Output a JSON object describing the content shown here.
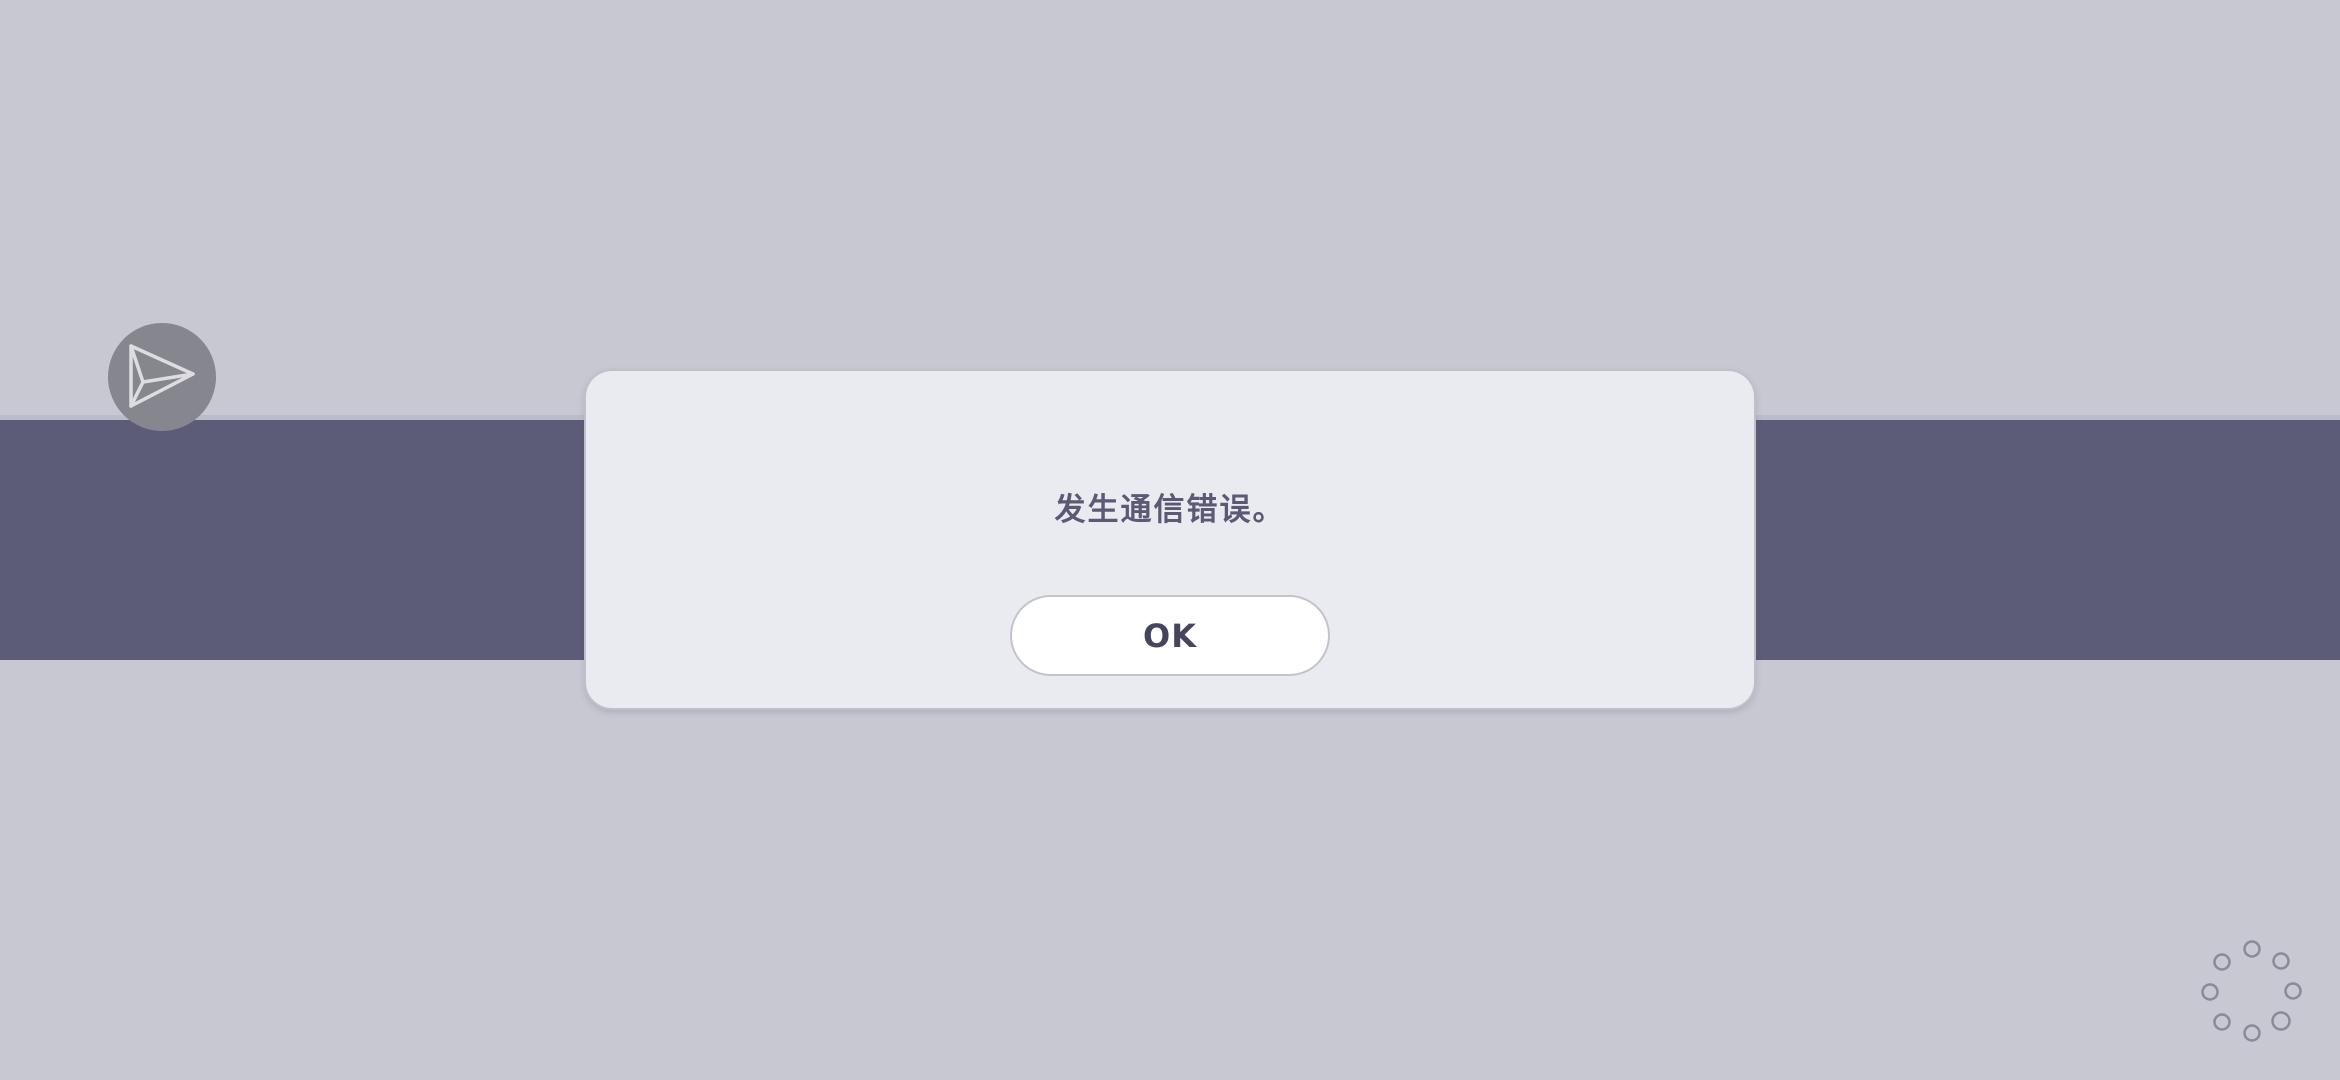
{
  "dialog": {
    "message": "发生通信错误。",
    "ok_label": "OK"
  },
  "icons": {
    "share": "paper-plane-icon",
    "loading": "loading-spinner-icon"
  },
  "colors": {
    "background": "#c8c8d2",
    "band": "#5d5c78",
    "dialog_bg": "#eaebf0",
    "message_text": "#5b5a75",
    "button_text": "#46455e"
  }
}
